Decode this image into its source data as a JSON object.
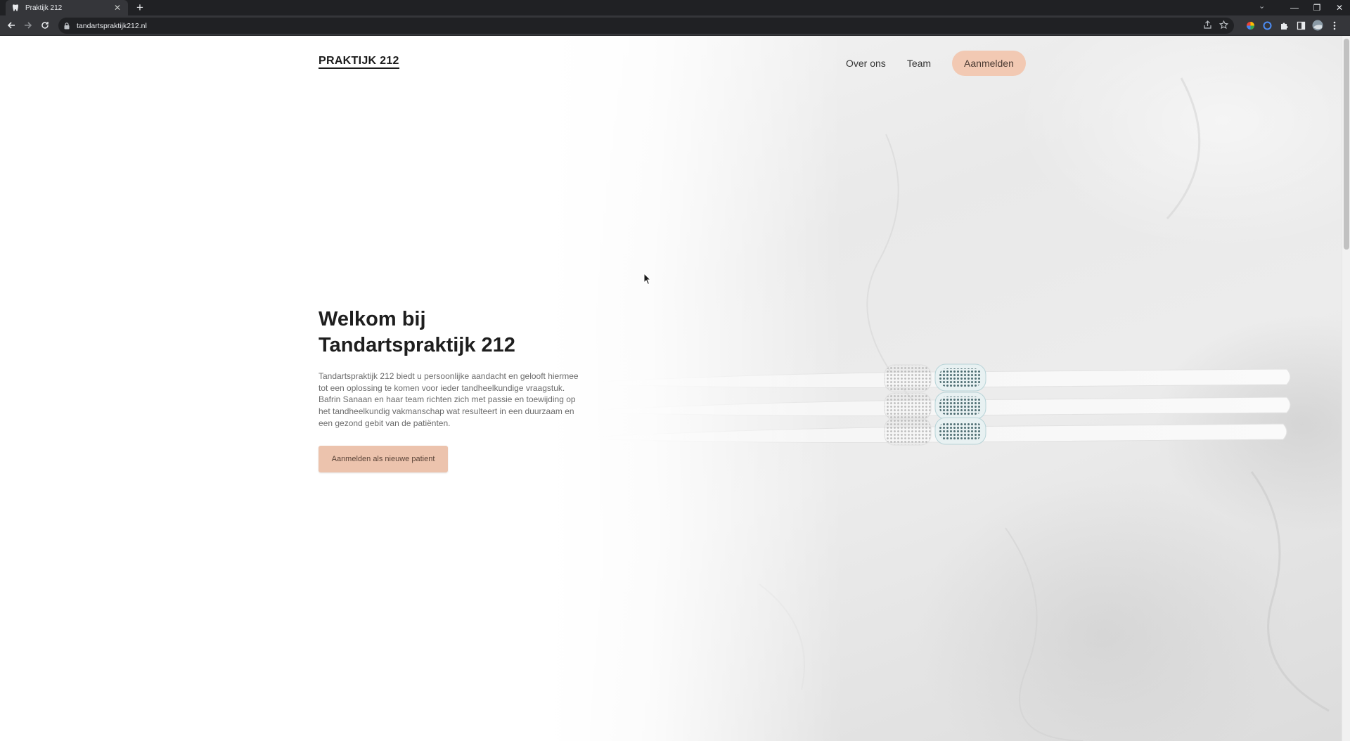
{
  "browser": {
    "tab_title": "Praktijk 212",
    "url": "tandartspraktijk212.nl"
  },
  "site": {
    "brand": "PRAKTIJK 212",
    "nav": {
      "about": "Over ons",
      "team": "Team",
      "signup": "Aanmelden"
    }
  },
  "hero": {
    "title_line1": "Welkom bij",
    "title_line2": "Tandartspraktijk 212",
    "text": "Tandartspraktijk 212 biedt u persoonlijke aandacht en gelooft hiermee tot een oplossing te komen voor ieder tandheelkundige vraagstuk. Bafrin Sanaan en haar team richten zich met passie en toewijding op het tandheelkundig vakmanschap wat resulteert in een duurzaam en een gezond gebit van de patiënten.",
    "cta": "Aanmelden als nieuwe patient"
  },
  "colors": {
    "accent": "#f2c9b3",
    "cta": "#ecc3ad",
    "chrome_dark": "#202124"
  },
  "icons": [
    "tooth-favicon",
    "back-icon",
    "forward-icon",
    "reload-icon",
    "lock-icon",
    "share-icon",
    "star-icon",
    "extension-icon",
    "puzzle-icon",
    "sidepanel-icon",
    "profile-avatar",
    "menu-icon",
    "minimize-icon",
    "restore-icon",
    "close-icon",
    "toothbrush-image"
  ]
}
